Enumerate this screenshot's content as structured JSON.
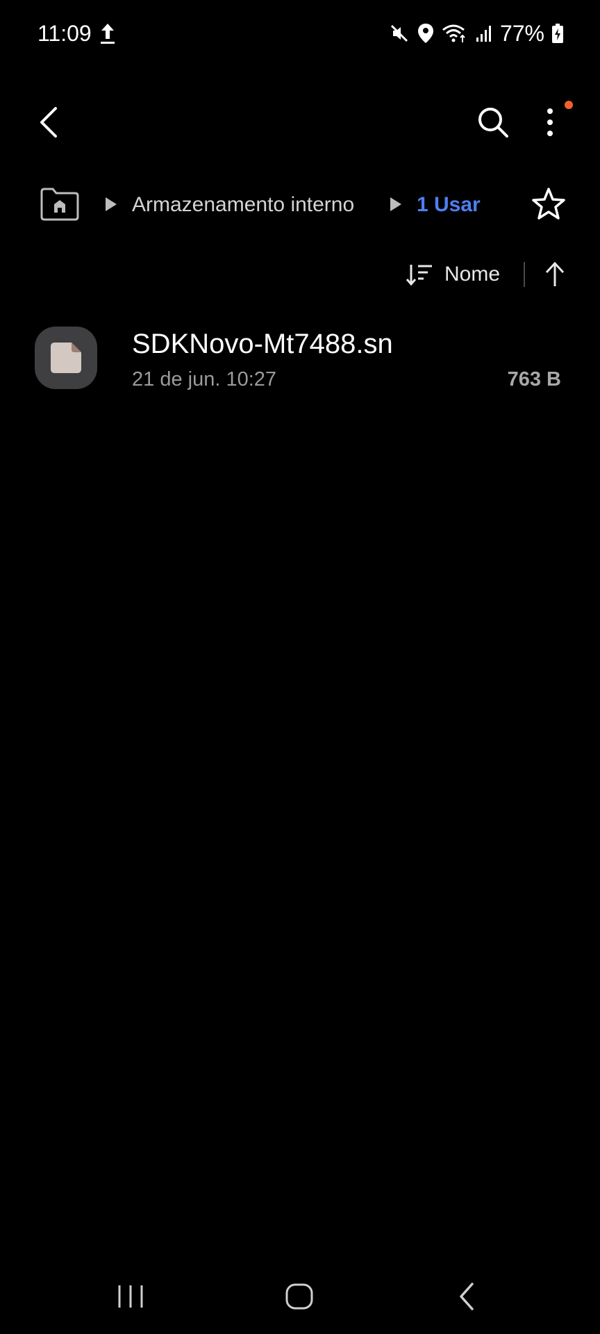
{
  "status_bar": {
    "time": "11:09",
    "battery": "77%",
    "icons": [
      "upload-icon",
      "mute-icon",
      "location-icon",
      "wifi-icon",
      "signal-icon",
      "battery-icon"
    ]
  },
  "app_bar": {
    "icons": [
      "back-icon",
      "search-icon",
      "more-vert-icon"
    ],
    "notification_dot_color": "#f2632b"
  },
  "breadcrumb": {
    "home_icon": "home-folder-icon",
    "items": [
      "Armazenamento interno",
      "1 Usar"
    ],
    "current_color": "#4e7ff2",
    "favorite_icon": "star-outline-icon"
  },
  "sort": {
    "label": "Nome",
    "direction_icon": "arrow-up-icon"
  },
  "files": [
    {
      "name": "SDKNovo-Mt7488.sn",
      "date": "21 de jun. 10:27",
      "size": "763 B",
      "icon": "file-icon"
    }
  ],
  "nav_bar": {
    "icons": [
      "recents-icon",
      "home-icon",
      "back-icon"
    ]
  }
}
